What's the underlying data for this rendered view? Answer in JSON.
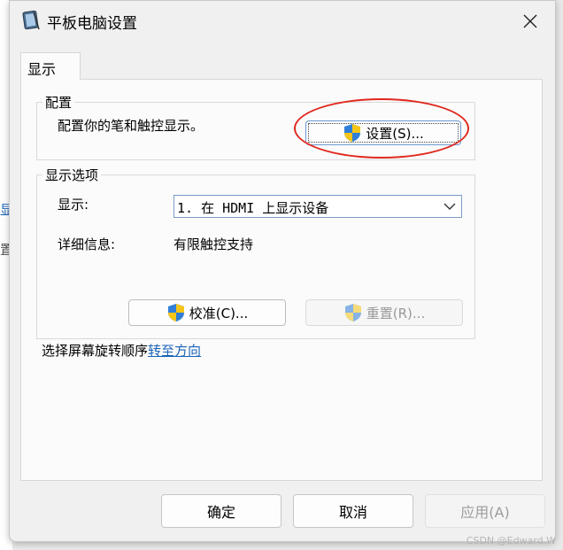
{
  "window": {
    "title": "平板电脑设置",
    "close_glyph": "✕"
  },
  "tabs": [
    {
      "label": "显示"
    }
  ],
  "configure": {
    "group_label": "配置",
    "description": "配置你的笔和触控显示。",
    "setup_button": "设置(S)..."
  },
  "display_options": {
    "group_label": "显示选项",
    "display_label": "显示:",
    "display_value": "1. 在 HDMI 上显示设备",
    "details_label": "详细信息:",
    "details_value": "有限触控支持",
    "calibrate_button": "校准(C)...",
    "reset_button": "重置(R)..."
  },
  "rotation": {
    "text": "选择屏幕旋转顺序",
    "link": "转至方向"
  },
  "footer": {
    "ok": "确定",
    "cancel": "取消",
    "apply": "应用(A)"
  },
  "background_fragments": [
    "显",
    "置"
  ],
  "watermark": "CSDN @Edward.W",
  "colors": {
    "link": "#1a63b8",
    "highlight_circle": "#e0281e",
    "shield_blue": "#2f7fd8",
    "shield_yellow": "#f5c518"
  },
  "icons": {
    "title": "tablet-settings-icon",
    "close": "close-icon",
    "shield": "uac-shield-icon",
    "dropdown": "chevron-down-icon"
  }
}
